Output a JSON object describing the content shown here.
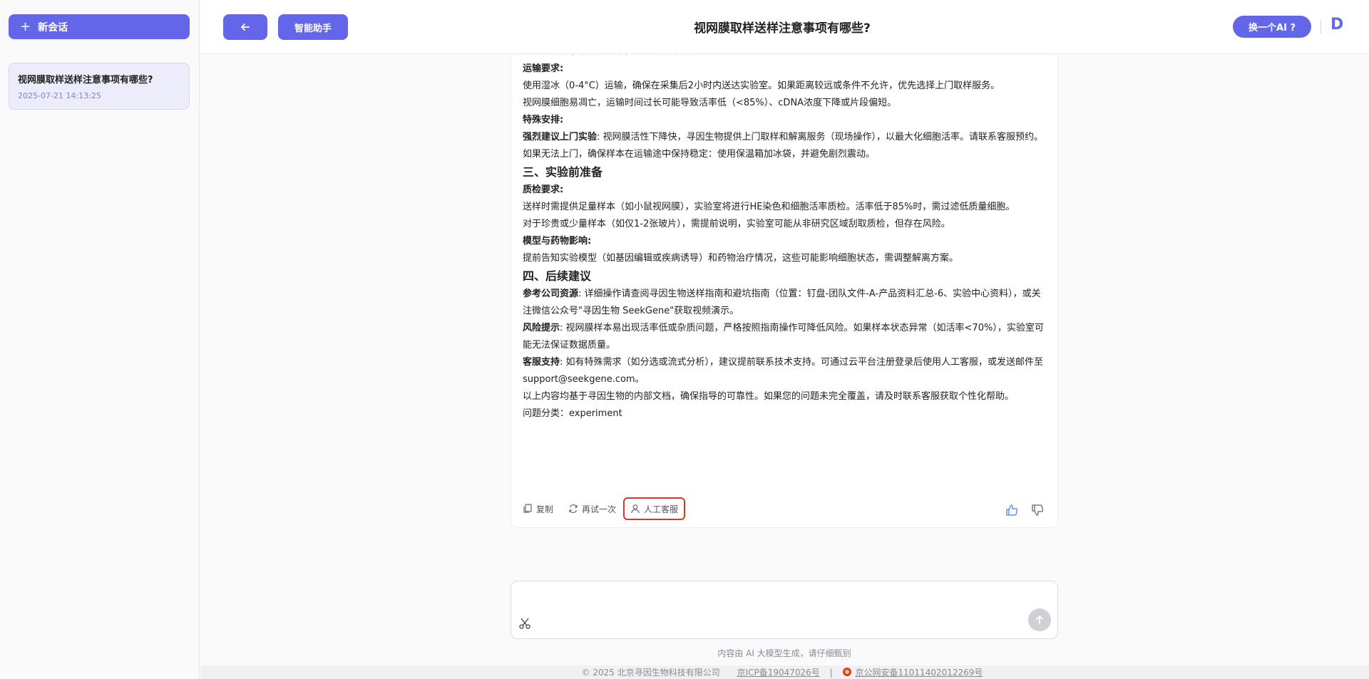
{
  "sidebar": {
    "new_chat_label": "新会话",
    "sessions": [
      {
        "title": "视网膜取样送样注意事项有哪些?",
        "time": "2025-07-21 14:13:25"
      }
    ]
  },
  "header": {
    "assistant_label": "智能助手",
    "title": "视网膜取样送样注意事项有哪些?",
    "switch_ai_label": "换一个AI ?",
    "logo": "D"
  },
  "message": {
    "lines": {
      "l0": "避免长时间暴露在光线下，以防活性下降。",
      "transport_head": "运输要求:",
      "l1": "使用湿冰（0-4°C）运输，确保在采集后2小时内送达实验室。如果距离较远或条件不允许，优先选择上门取样服务。",
      "l2": "视网膜细胞易凋亡，运输时间过长可能导致活率低（<85%）、cDNA浓度下降或片段偏短。",
      "special_head": "特殊安排:",
      "l3_bold": "强烈建议上门实验",
      "l3": ": 视网膜活性下降快，寻因生物提供上门取样和解离服务（现场操作），以最大化细胞活率。请联系客服预约。",
      "l4": "如果无法上门，确保样本在运输途中保持稳定：使用保温箱加冰袋，并避免剧烈震动。",
      "sec3": "三、实验前准备",
      "qc_head": "质检要求:",
      "l5": "送样时需提供足量样本（如小鼠视网膜），实验室将进行HE染色和细胞活率质检。活率低于85%时，需过滤低质量细胞。",
      "l6": "对于珍贵或少量样本（如仅1-2张玻片），需提前说明，实验室可能从非研究区域刮取质检，但存在风险。",
      "model_head": "模型与药物影响:",
      "l7": "提前告知实验模型（如基因编辑或疾病诱导）和药物治疗情况，这些可能影响细胞状态，需调整解离方案。",
      "sec4": "四、后续建议",
      "ref_bold": "参考公司资源",
      "ref": ": 详细操作请查阅寻因生物送样指南和避坑指南（位置：钉盘-团队文件-A-产品资料汇总-6、实验中心资料），或关注微信公众号\"寻因生物 SeekGene\"获取视频演示。",
      "risk_bold": "风险提示",
      "risk": ": 视网膜样本易出现活率低或杂质问题，严格按照指南操作可降低风险。如果样本状态异常（如活率<70%），实验室可能无法保证数据质量。",
      "cs_bold": "客服支持",
      "cs": ": 如有特殊需求（如分选或流式分析），建议提前联系技术支持。可通过云平台注册登录后使用人工客服，或发送邮件至support@seekgene.com。",
      "l8": "以上内容均基于寻因生物的内部文档，确保指导的可靠性。如果您的问题未完全覆盖，请及时联系客服获取个性化帮助。",
      "category": "问题分类：experiment"
    },
    "actions": {
      "copy": "复制",
      "retry": "再试一次",
      "human": "人工客服"
    }
  },
  "input": {
    "placeholder": ""
  },
  "disclaimer": "内容由 AI 大模型生成，请仔细甄别",
  "footer": {
    "copyright": "© 2025 北京寻因生物科技有限公司",
    "icp": "京ICP备19047026号",
    "sep": "|",
    "police": "京公网安备11011402012269号"
  },
  "colors": {
    "accent": "#6366e8",
    "highlight_border": "#e0322b",
    "like_active": "#4f7ff0"
  }
}
